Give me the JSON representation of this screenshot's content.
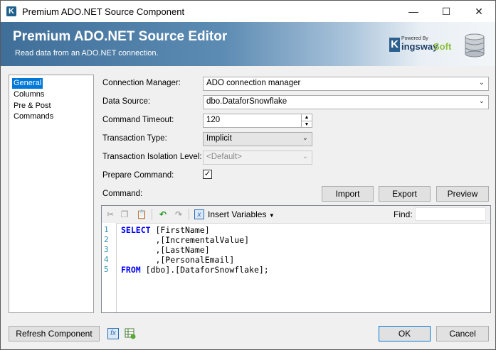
{
  "window": {
    "title": "Premium ADO.NET Source Component",
    "app_icon": "K",
    "controls": [
      "minimize-icon",
      "maximize-icon",
      "close-icon"
    ]
  },
  "banner": {
    "title": "Premium ADO.NET Source Editor",
    "subtitle": "Read data from an ADO.NET connection.",
    "logo": {
      "powered_by": "Powered By",
      "k": "K",
      "ingsway": "ingsway",
      "soft": "Soft"
    }
  },
  "nav": {
    "items": [
      {
        "label": "General",
        "selected": true
      },
      {
        "label": "Columns",
        "selected": false
      },
      {
        "label": "Pre & Post Commands",
        "selected": false
      }
    ]
  },
  "form": {
    "connection_manager": {
      "label": "Connection Manager:",
      "value": "ADO connection manager"
    },
    "data_source": {
      "label": "Data Source:",
      "value": "dbo.DataforSnowflake"
    },
    "command_timeout": {
      "label": "Command Timeout:",
      "value": "120"
    },
    "transaction_type": {
      "label": "Transaction Type:",
      "value": "Implicit"
    },
    "isolation_level": {
      "label": "Transaction Isolation Level:",
      "value": "<Default>"
    },
    "prepare_command": {
      "label": "Prepare Command:",
      "checked": true
    },
    "command": {
      "label": "Command:"
    },
    "buttons": {
      "import": "Import",
      "export": "Export",
      "preview": "Preview"
    }
  },
  "editor": {
    "insert_variables": "Insert Variables",
    "find_label": "Find:",
    "find_value": "",
    "lines": [
      {
        "n": "1",
        "kw": "SELECT",
        "rest": " [FirstName]"
      },
      {
        "n": "2",
        "kw": "",
        "rest": "       ,[IncrementalValue]"
      },
      {
        "n": "3",
        "kw": "",
        "rest": "       ,[LastName]"
      },
      {
        "n": "4",
        "kw": "",
        "rest": "       ,[PersonalEmail]"
      },
      {
        "n": "5",
        "kw": "FROM",
        "rest": " [dbo].[DataforSnowflake];"
      }
    ]
  },
  "footer": {
    "refresh": "Refresh Component",
    "ok": "OK",
    "cancel": "Cancel"
  },
  "colors": {
    "selection": "#0078d7",
    "keyword": "#0000ff",
    "line_number": "#2b91af",
    "logo_green": "#8bbf3a"
  }
}
